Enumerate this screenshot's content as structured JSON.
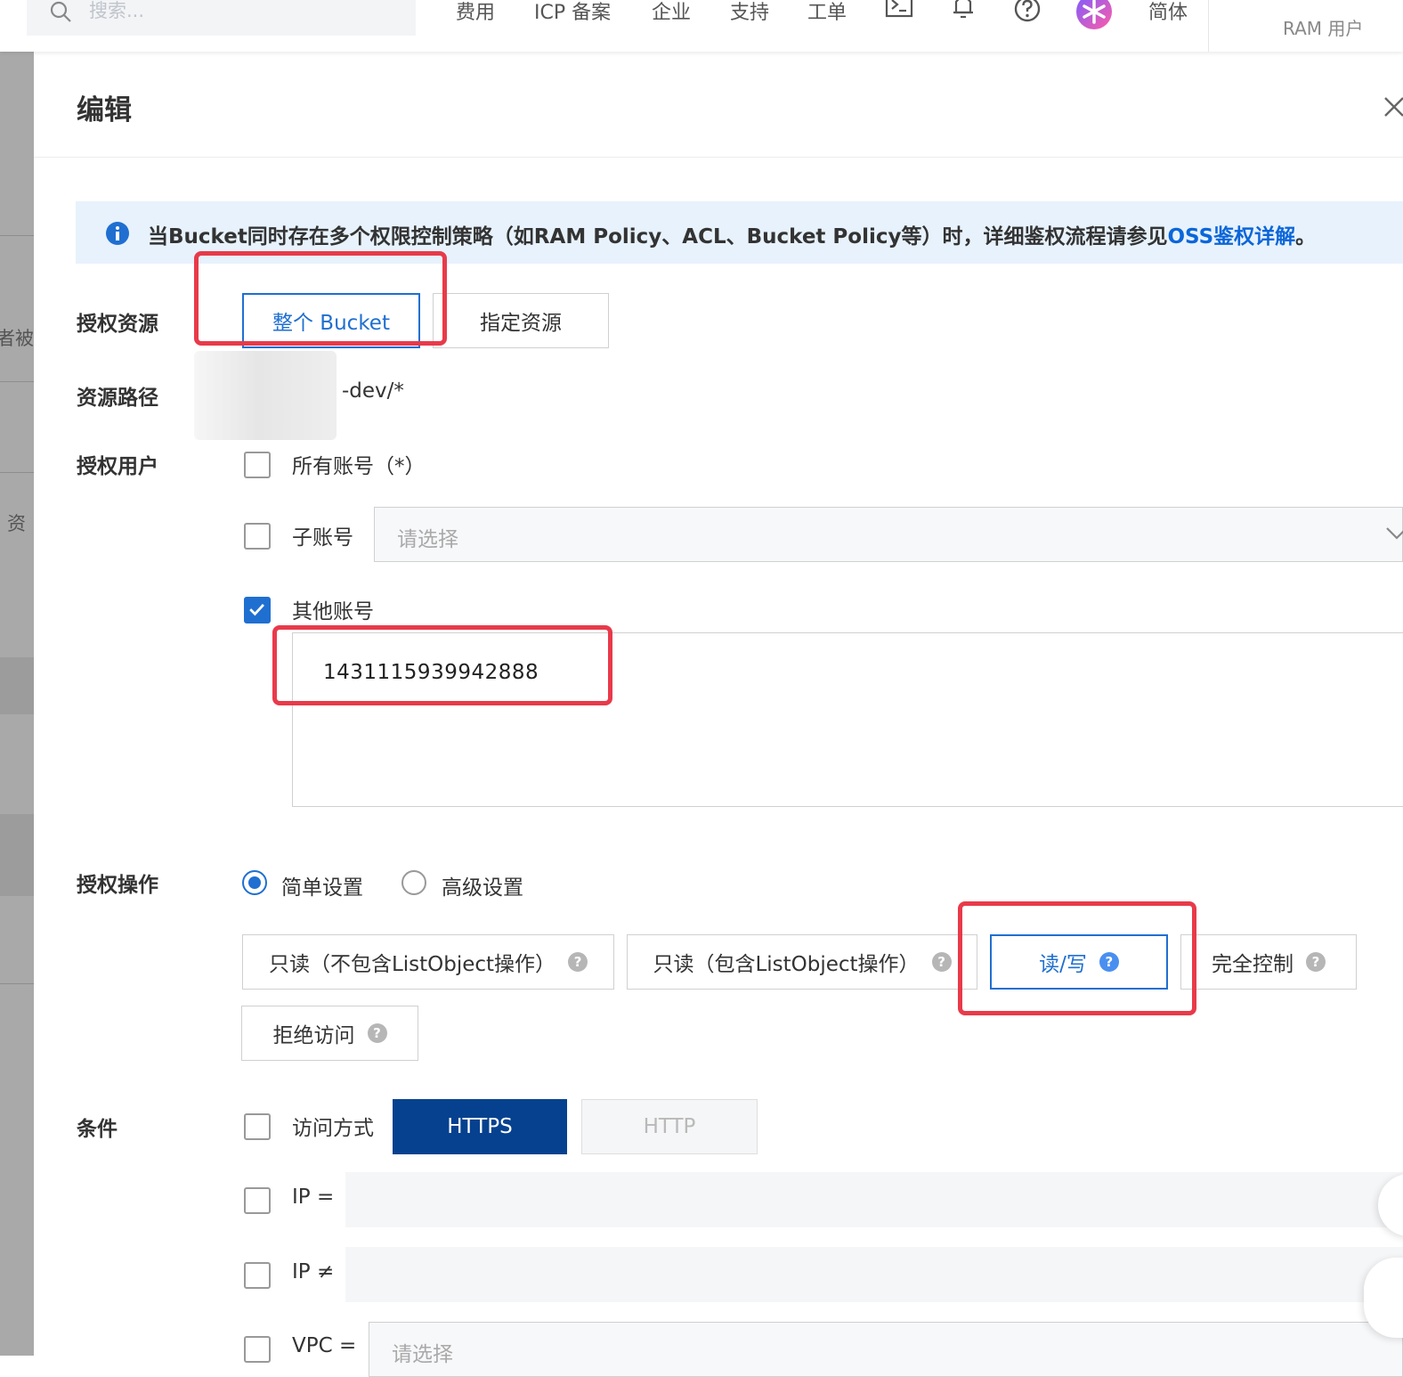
{
  "topbar": {
    "search_placeholder": "搜索...",
    "nav": [
      "费用",
      "ICP 备案",
      "企业",
      "支持",
      "工单"
    ],
    "language": "简体",
    "account_type": "RAM 用户",
    "icons": [
      "terminal-icon",
      "bell-icon",
      "help-icon",
      "app-icon"
    ],
    "notification_color": "#ff6a00"
  },
  "background_page": {
    "fragments": [
      "者被",
      "资"
    ]
  },
  "drawer": {
    "title": "编辑",
    "notice": {
      "text": "当Bucket同时存在多个权限控制策略（如RAM Policy、ACL、Bucket Policy等）时，详细鉴权流程请参见",
      "link": "OSS鉴权详解",
      "suffix": "。"
    },
    "resource": {
      "label": "授权资源",
      "options": [
        "整个 Bucket",
        "指定资源"
      ],
      "selected": "整个 Bucket"
    },
    "path": {
      "label": "资源路径",
      "value": "-dev/*"
    },
    "users": {
      "label": "授权用户",
      "all_accounts": {
        "label": "所有账号（*）",
        "checked": false
      },
      "sub_accounts": {
        "label": "子账号",
        "checked": false,
        "placeholder": "请选择"
      },
      "other_accounts": {
        "label": "其他账号",
        "checked": true,
        "value": "1431115939942888"
      }
    },
    "actions": {
      "label": "授权操作",
      "modes": [
        {
          "label": "简单设置",
          "selected": true
        },
        {
          "label": "高级设置",
          "selected": false
        }
      ],
      "options": [
        {
          "label": "只读（不包含ListObject操作）",
          "selected": false
        },
        {
          "label": "只读（包含ListObject操作）",
          "selected": false
        },
        {
          "label": "读/写",
          "selected": true
        },
        {
          "label": "完全控制",
          "selected": false
        },
        {
          "label": "拒绝访问",
          "selected": false
        }
      ]
    },
    "conditions": {
      "label": "条件",
      "access_method": {
        "label": "访问方式",
        "checked": false,
        "protocols": [
          "HTTPS",
          "HTTP"
        ],
        "selected": "HTTPS"
      },
      "ip_equals": {
        "label": "IP =",
        "checked": false
      },
      "ip_not_equals": {
        "label": "IP ≠",
        "checked": false
      },
      "vpc": {
        "label": "VPC =",
        "checked": false,
        "placeholder": "请选择"
      }
    }
  },
  "colors": {
    "primary": "#1f6fd1",
    "link": "#0b66d9",
    "notice_bg": "#e7f2fc",
    "https_bg": "#06418f",
    "annotation": "#e83a4a"
  }
}
